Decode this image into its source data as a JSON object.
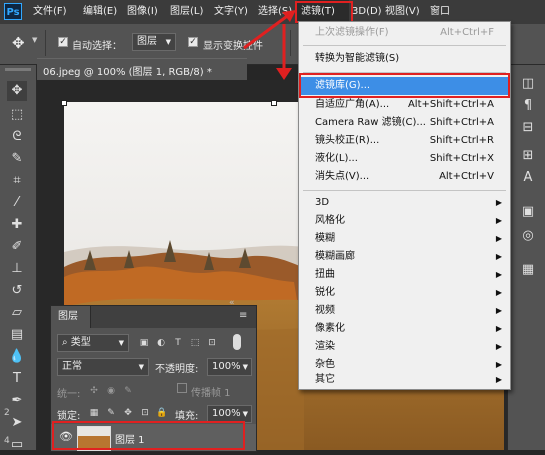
{
  "menubar": {
    "logo": "Ps",
    "items": [
      "文件(F)",
      "编辑(E)",
      "图像(I)",
      "图层(L)",
      "文字(Y)",
      "选择(S)",
      "滤镜(T)",
      "3D(D)",
      "视图(V)",
      "窗口"
    ],
    "active_item": "滤镜(T)"
  },
  "options": {
    "auto_select_label": "自动选择：",
    "auto_select_target": "图层",
    "show_transform_label": "显示变换控件"
  },
  "document": {
    "tab_title": "06.jpeg @ 100% (图层 1, RGB/8) *"
  },
  "filter_menu": {
    "top_items": [
      {
        "label": "上次滤镜操作(F)",
        "shortcut": "Alt+Ctrl+F",
        "disabled": true
      },
      {
        "label": "转换为智能滤镜(S)",
        "shortcut": "",
        "disabled": false
      }
    ],
    "main_items": [
      {
        "label": "滤镜库(G)...",
        "shortcut": "",
        "highlighted": true
      },
      {
        "label": "自适应广角(A)...",
        "shortcut": "Alt+Shift+Ctrl+A"
      },
      {
        "label": "Camera Raw 滤镜(C)...",
        "shortcut": "Shift+Ctrl+A"
      },
      {
        "label": "镜头校正(R)...",
        "shortcut": "Shift+Ctrl+R"
      },
      {
        "label": "液化(L)...",
        "shortcut": "Shift+Ctrl+X"
      },
      {
        "label": "消失点(V)...",
        "shortcut": "Alt+Ctrl+V"
      }
    ],
    "submenus": [
      "3D",
      "风格化",
      "模糊",
      "模糊画廊",
      "扭曲",
      "锐化",
      "视频",
      "像素化",
      "渲染",
      "杂色",
      "其它"
    ]
  },
  "layers_panel": {
    "tab_label": "图层",
    "filter_kind": "类型",
    "blend_mode": "正常",
    "opacity_label": "不透明度:",
    "opacity_value": "100%",
    "unify_label": "统一:",
    "propagate_label": "传播帧 1",
    "lock_label": "锁定:",
    "fill_label": "填充:",
    "fill_value": "100%",
    "layer_name": "图层 1",
    "left_numbers": [
      "2",
      "4"
    ]
  },
  "colors": {
    "highlight": "#3d8ee6",
    "annotation_red": "#e02020",
    "ps_blue": "#31a8ff"
  }
}
